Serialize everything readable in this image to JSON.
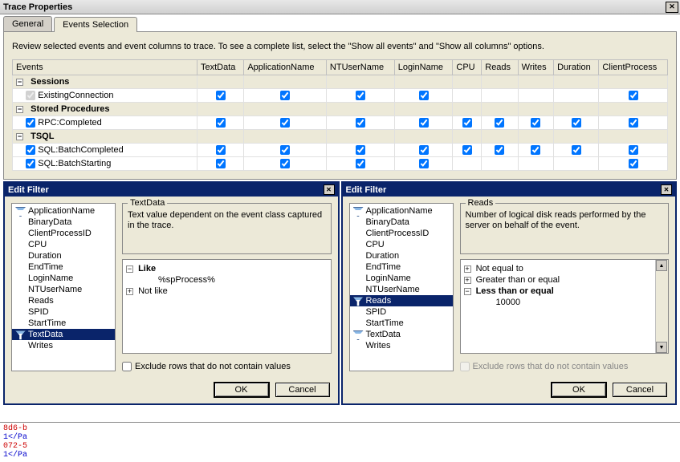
{
  "window_title": "Trace Properties",
  "tabs": {
    "general": "General",
    "events_selection": "Events Selection"
  },
  "instruction": "Review selected events and event columns to trace. To see a complete list, select the \"Show all events\" and \"Show all columns\" options.",
  "columns": [
    "Events",
    "TextData",
    "ApplicationName",
    "NTUserName",
    "LoginName",
    "CPU",
    "Reads",
    "Writes",
    "Duration",
    "ClientProcess"
  ],
  "categories": [
    {
      "name": "Sessions",
      "expanded": true,
      "events": [
        {
          "name": "ExistingConnection",
          "locked": true,
          "checks": [
            true,
            true,
            true,
            true,
            null,
            null,
            null,
            null,
            true
          ]
        }
      ]
    },
    {
      "name": "Stored Procedures",
      "expanded": true,
      "events": [
        {
          "name": "RPC:Completed",
          "locked": false,
          "checks": [
            true,
            true,
            true,
            true,
            true,
            true,
            true,
            true,
            true
          ]
        }
      ]
    },
    {
      "name": "TSQL",
      "expanded": true,
      "events": [
        {
          "name": "SQL:BatchCompleted",
          "locked": false,
          "checks": [
            true,
            true,
            true,
            true,
            true,
            true,
            true,
            true,
            true
          ]
        },
        {
          "name": "SQL:BatchStarting",
          "locked": false,
          "checks": [
            true,
            true,
            true,
            true,
            null,
            null,
            null,
            null,
            true
          ]
        }
      ]
    }
  ],
  "edit_filter_title": "Edit Filter",
  "fields": [
    "ApplicationName",
    "BinaryData",
    "ClientProcessID",
    "CPU",
    "Duration",
    "EndTime",
    "LoginName",
    "NTUserName",
    "Reads",
    "SPID",
    "StartTime",
    "TextData",
    "Writes"
  ],
  "left_dialog": {
    "selected": "TextData",
    "filtered": [
      "ApplicationName",
      "TextData"
    ],
    "group_title": "TextData",
    "desc": "Text value dependent on the event class captured in the trace.",
    "criteria": {
      "like": {
        "label": "Like",
        "children": [
          "%spProcess%"
        ]
      },
      "notlike": {
        "label": "Not like"
      }
    },
    "exclude_label": "Exclude rows that do not contain values",
    "exclude_enabled": true
  },
  "right_dialog": {
    "selected": "Reads",
    "filtered": [
      "ApplicationName",
      "Reads",
      "TextData"
    ],
    "group_title": "Reads",
    "desc": "Number of logical disk reads performed by the server on behalf of the event.",
    "criteria": {
      "ne": {
        "label": "Not equal to"
      },
      "gte": {
        "label": "Greater than or equal"
      },
      "lte": {
        "label": "Less than or equal",
        "children": [
          "10000"
        ],
        "expanded": true
      }
    },
    "exclude_label": "Exclude rows that do not contain values",
    "exclude_enabled": false
  },
  "buttons": {
    "ok": "OK",
    "cancel": "Cancel"
  },
  "bottom_lines": [
    "8d6-b",
    "1</Pa",
    "072-5",
    "1</Pa"
  ]
}
